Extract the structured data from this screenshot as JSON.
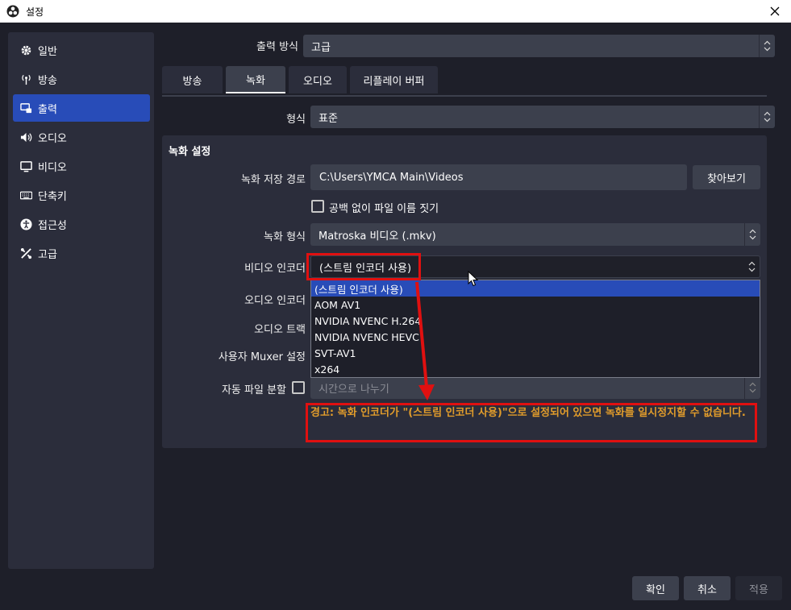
{
  "window": {
    "title": "설정"
  },
  "sidebar": {
    "items": [
      {
        "label": "일반",
        "icon": "gear-icon",
        "active": false
      },
      {
        "label": "방송",
        "icon": "broadcast-icon",
        "active": false
      },
      {
        "label": "출력",
        "icon": "output-icon",
        "active": true
      },
      {
        "label": "오디오",
        "icon": "speaker-icon",
        "active": false
      },
      {
        "label": "비디오",
        "icon": "monitor-icon",
        "active": false
      },
      {
        "label": "단축키",
        "icon": "keyboard-icon",
        "active": false
      },
      {
        "label": "접근성",
        "icon": "accessibility-icon",
        "active": false
      },
      {
        "label": "고급",
        "icon": "tools-icon",
        "active": false
      }
    ]
  },
  "output_mode": {
    "label": "출력 방식",
    "value": "고급"
  },
  "tabs": [
    {
      "label": "방송",
      "active": false
    },
    {
      "label": "녹화",
      "active": true
    },
    {
      "label": "오디오",
      "active": false
    },
    {
      "label": "리플레이 버퍼",
      "active": false
    }
  ],
  "format_type": {
    "label": "형식",
    "value": "표준"
  },
  "recording": {
    "group_title": "녹화 설정",
    "path_label": "녹화 저장 경로",
    "path_value": "C:\\Users\\YMCA Main\\Videos",
    "browse_label": "찾아보기",
    "nospace_label": "공백 없이 파일 이름 짓기",
    "format_label": "녹화 형식",
    "format_value": "Matroska 비디오 (.mkv)",
    "video_encoder_label": "비디오 인코더",
    "video_encoder_value": "(스트림 인코더 사용)",
    "audio_encoder_label": "오디오 인코더",
    "audio_track_label": "오디오 트랙",
    "muxer_label": "사용자 Muxer 설정",
    "split_label": "자동 파일 분할",
    "split_value": "시간으로 나누기",
    "warning": "경고: 녹화 인코더가 \"(스트림 인코더 사용)\"으로 설정되어 있으면 녹화를 일시정지할 수 없습니다."
  },
  "encoder_options": [
    "(스트림 인코더 사용)",
    "AOM AV1",
    "NVIDIA NVENC H.264",
    "NVIDIA NVENC HEVC",
    "SVT-AV1",
    "x264"
  ],
  "footer": {
    "ok": "확인",
    "cancel": "취소",
    "apply": "적용"
  },
  "colors": {
    "accent": "#284cb8",
    "warning": "#e19c2b",
    "annotation": "#e01010"
  }
}
